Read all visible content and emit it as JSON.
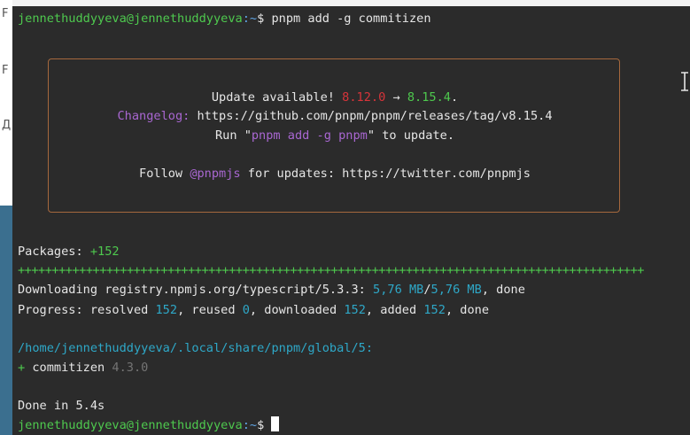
{
  "background_window": {
    "chars": [
      "F",
      "F",
      "Д"
    ]
  },
  "terminal": {
    "command_line": {
      "user_host": "jennethuddyyeva@jennethuddyyeva",
      "path": ":~",
      "prompt": "$",
      "command": "pnpm add -g commitizen"
    },
    "update_box": {
      "line1_prefix": "Update available! ",
      "current_version": "8.12.0",
      "arrow": " → ",
      "new_version": "8.15.4",
      "line1_suffix": ".",
      "changelog_label": "Changelog:",
      "changelog_url": " https://github.com/pnpm/pnpm/releases/tag/v8.15.4",
      "run_prefix": "Run \"",
      "run_command": "pnpm add -g pnpm",
      "run_suffix": "\" to update.",
      "follow_prefix": "Follow ",
      "follow_handle": "@pnpmjs",
      "follow_suffix": " for updates: https://twitter.com/pnpmjs"
    },
    "packages": {
      "label": "Packages: ",
      "count": "+152"
    },
    "progress_bar": "++++++++++++++++++++++++++++++++++++++++++++++++++++++++++++++++++++++++++++++++++++++++++++",
    "downloading": {
      "prefix": "Downloading registry.npmjs.org/typescript/5.3.3: ",
      "size_done": "5,76 MB",
      "sep": "/",
      "size_total": "5,76 MB",
      "suffix": ", done"
    },
    "progress": {
      "p1": "Progress: resolved ",
      "resolved": "152",
      "p2": ", reused ",
      "reused": "0",
      "p3": ", downloaded ",
      "downloaded": "152",
      "p4": ", added ",
      "added": "152",
      "p5": ", done"
    },
    "global_path": "/home/jennethuddyyeva/.local/share/pnpm/global/5:",
    "installed": {
      "plus": "+",
      "name": " commitizen ",
      "version": "4.3.0"
    },
    "done_line": "Done in 5.4s",
    "final_prompt": {
      "user_host": "jennethuddyyeva@jennethuddyyeva",
      "path": ":~",
      "prompt": "$ "
    }
  },
  "colors": {
    "terminal_bg": "#2b2b2b",
    "green": "#4ec94e",
    "red": "#d8343a",
    "purple": "#a967d2",
    "cyan": "#2ea8c8",
    "box_border": "#a5683d"
  }
}
